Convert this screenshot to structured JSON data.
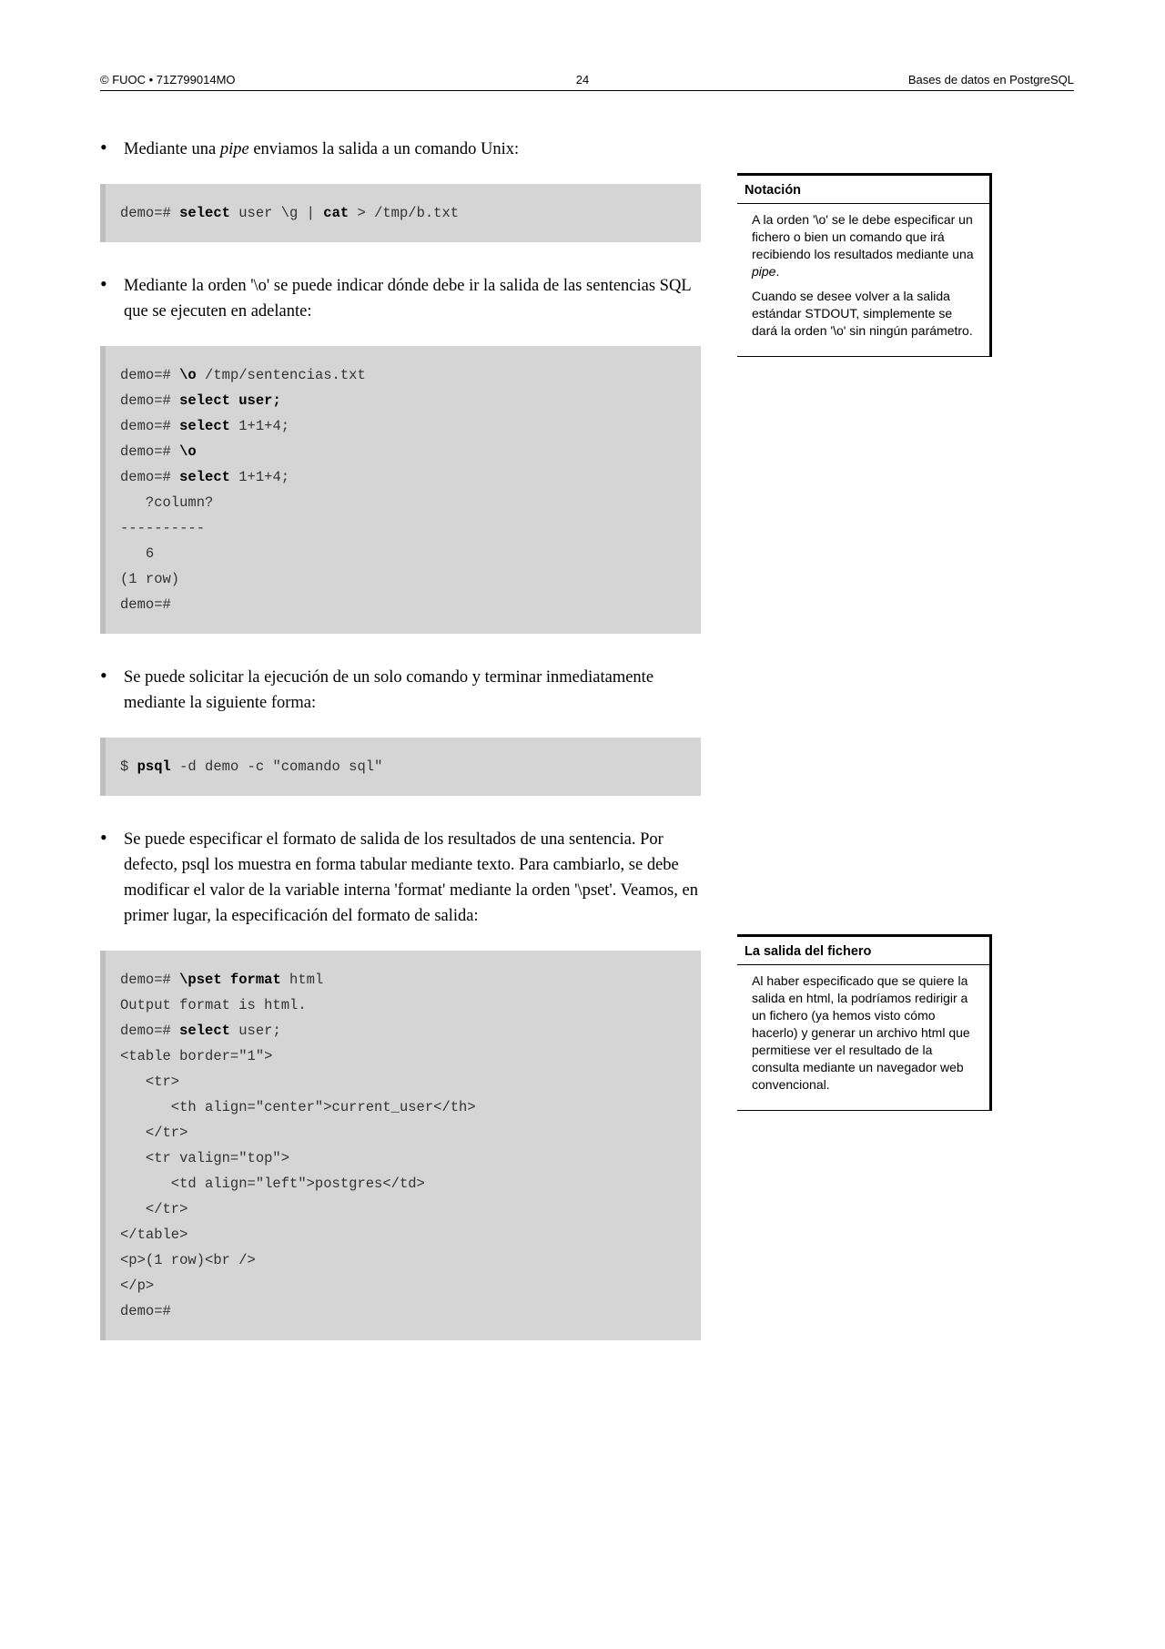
{
  "header": {
    "left": "© FUOC • 71Z799014MO",
    "center": "24",
    "right": "Bases de datos en PostgreSQL"
  },
  "bullets": {
    "b1_pre": "Mediante una ",
    "b1_em": "pipe",
    "b1_post": " enviamos la salida a un comando Unix:",
    "b2": "Mediante la orden '\\o' se puede indicar dónde debe ir la salida de las sentencias SQL que se ejecuten en adelante:",
    "b3": "Se puede solicitar la ejecución de un solo comando y terminar inmediatamente mediante la siguiente forma:",
    "b4": "Se puede especificar el formato de salida de los resultados de una sentencia. Por defecto, psql los muestra en forma tabular mediante texto. Para cambiarlo, se debe modificar el valor de la variable interna 'format' mediante la orden '\\pset'. Veamos, en primer lugar, la especificación del formato de salida:"
  },
  "code": {
    "c1": {
      "p1": "demo=# ",
      "b1": "select",
      "p2": " user \\g | ",
      "b2": "cat",
      "p3": " > /tmp/b.txt"
    },
    "c2": {
      "l1a": "demo=# ",
      "l1b": "\\o",
      "l1c": " /tmp/sentencias.txt",
      "l2a": "demo=# ",
      "l2b": "select user;",
      "l3a": "demo=# ",
      "l3b": "select",
      "l3c": " 1+1+4;",
      "l4a": "demo=# ",
      "l4b": "\\o",
      "l5a": "demo=# ",
      "l5b": "select",
      "l5c": " 1+1+4;",
      "l6": "   ?column?",
      "l7": "----------",
      "l8": "   6",
      "l9": "(1 row)",
      "l10": "demo=#"
    },
    "c3": {
      "p1": "$ ",
      "b1": "psql",
      "p2": " -d demo -c \"comando sql\""
    },
    "c4": {
      "l1a": "demo=# ",
      "l1b": "\\pset format",
      "l1c": " html",
      "l2": "Output format is html.",
      "l3a": "demo=# ",
      "l3b": "select",
      "l3c": " user;",
      "l4": "<table border=\"1\">",
      "l5": "   <tr>",
      "l6": "      <th align=\"center\">current_user</th>",
      "l7": "   </tr>",
      "l8": "   <tr valign=\"top\">",
      "l9": "      <td align=\"left\">postgres</td>",
      "l10": "   </tr>",
      "l11": "</table>",
      "l12": "<p>(1 row)<br />",
      "l13": "</p>",
      "l14": "demo=#"
    }
  },
  "sidebar": {
    "note1": {
      "title": "Notación",
      "p1_pre": "A la orden '\\o' se le debe especificar un fichero o bien un comando que irá recibiendo los resultados mediante una ",
      "p1_em": "pipe",
      "p1_post": ".",
      "p2": "Cuando se desee volver a la salida estándar STDOUT, simplemente se dará la orden '\\o' sin ningún parámetro."
    },
    "note2": {
      "title": "La salida del fichero",
      "p1": "Al haber especificado que se quiere la salida en html, la podríamos redirigir a un fichero (ya hemos visto cómo hacerlo) y generar un archivo html que permitiese ver el resultado de la consulta mediante un navegador web convencional."
    }
  }
}
